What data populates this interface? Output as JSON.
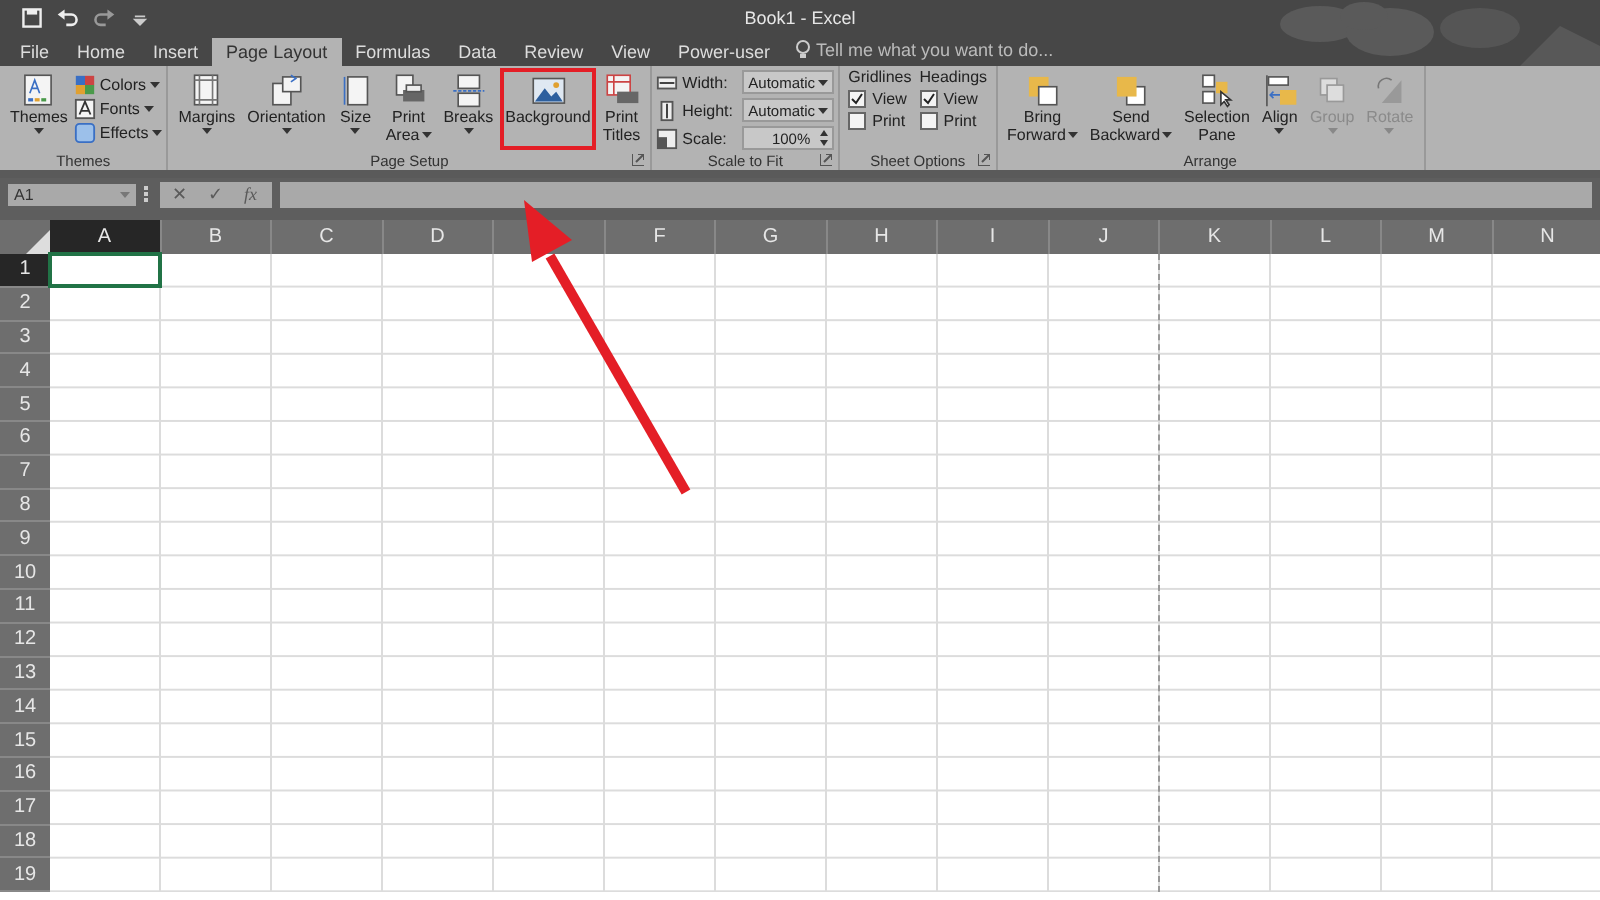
{
  "window": {
    "title": "Book1 - Excel"
  },
  "quick_access": [
    {
      "kind": "save"
    },
    {
      "kind": "undo"
    },
    {
      "kind": "redo"
    },
    {
      "kind": "customize"
    }
  ],
  "tabs": [
    {
      "label": "File",
      "selected": false
    },
    {
      "label": "Home",
      "selected": false
    },
    {
      "label": "Insert",
      "selected": false
    },
    {
      "label": "Page Layout",
      "selected": true
    },
    {
      "label": "Formulas",
      "selected": false
    },
    {
      "label": "Data",
      "selected": false
    },
    {
      "label": "Review",
      "selected": false
    },
    {
      "label": "View",
      "selected": false
    },
    {
      "label": "Power-user",
      "selected": false
    }
  ],
  "tell_me": {
    "placeholder": "Tell me what you want to do..."
  },
  "ribbon": {
    "groups": [
      {
        "label": "Themes",
        "launcher": false,
        "items": [
          {
            "kind": "big",
            "lines": [
              "Themes"
            ],
            "dropdown": true,
            "disabled": false,
            "highlighted": false
          },
          {
            "kind": "smalls",
            "entries": [
              {
                "label": "Colors"
              },
              {
                "label": "Fonts"
              },
              {
                "label": "Effects"
              }
            ]
          }
        ]
      },
      {
        "label": "Page Setup",
        "launcher": true,
        "items": [
          {
            "kind": "big",
            "lines": [
              "Margins"
            ],
            "dropdown": true,
            "disabled": false,
            "highlighted": false
          },
          {
            "kind": "big",
            "lines": [
              "Orientation"
            ],
            "dropdown": true,
            "disabled": false,
            "highlighted": false
          },
          {
            "kind": "big",
            "lines": [
              "Size"
            ],
            "dropdown": true,
            "disabled": false,
            "highlighted": false
          },
          {
            "kind": "big",
            "lines": [
              "Print",
              "Area"
            ],
            "dropdown": true,
            "disabled": false,
            "highlighted": false
          },
          {
            "kind": "big",
            "lines": [
              "Breaks"
            ],
            "dropdown": true,
            "disabled": false,
            "highlighted": false
          },
          {
            "kind": "big",
            "lines": [
              "Background"
            ],
            "dropdown": false,
            "disabled": false,
            "highlighted": true
          },
          {
            "kind": "big",
            "lines": [
              "Print",
              "Titles"
            ],
            "dropdown": false,
            "disabled": false,
            "highlighted": false
          }
        ]
      },
      {
        "label": "Scale to Fit",
        "launcher": true,
        "items": [
          {
            "kind": "fields",
            "rows": [
              {
                "kind": "dropdown",
                "label": "Width:",
                "value": "Automatic"
              },
              {
                "kind": "dropdown",
                "label": "Height:",
                "value": "Automatic"
              },
              {
                "kind": "spinner",
                "label": "Scale:",
                "value": "100%"
              }
            ]
          }
        ]
      },
      {
        "label": "Sheet Options",
        "launcher": true,
        "items": [
          {
            "kind": "checks",
            "heading": "Gridlines",
            "options": [
              {
                "label": "View",
                "checked": true
              },
              {
                "label": "Print",
                "checked": false
              }
            ]
          },
          {
            "kind": "checks",
            "heading": "Headings",
            "options": [
              {
                "label": "View",
                "checked": true
              },
              {
                "label": "Print",
                "checked": false
              }
            ]
          }
        ]
      },
      {
        "label": "Arrange",
        "launcher": false,
        "items": [
          {
            "kind": "big",
            "lines": [
              "Bring",
              "Forward"
            ],
            "dropdown": true,
            "disabled": false,
            "highlighted": false
          },
          {
            "kind": "big",
            "lines": [
              "Send",
              "Backward"
            ],
            "dropdown": true,
            "disabled": false,
            "highlighted": false
          },
          {
            "kind": "big",
            "lines": [
              "Selection",
              "Pane"
            ],
            "dropdown": false,
            "disabled": false,
            "highlighted": false
          },
          {
            "kind": "big",
            "lines": [
              "Align"
            ],
            "dropdown": true,
            "disabled": false,
            "highlighted": false
          },
          {
            "kind": "big",
            "lines": [
              "Group"
            ],
            "dropdown": true,
            "disabled": true,
            "highlighted": false
          },
          {
            "kind": "big",
            "lines": [
              "Rotate"
            ],
            "dropdown": true,
            "disabled": true,
            "highlighted": false
          }
        ]
      }
    ]
  },
  "formula_bar": {
    "name_box": "A1",
    "cancel": "✕",
    "enter": "✓",
    "function": "fx"
  },
  "sheet": {
    "columns": [
      {
        "label": "A",
        "selected": true,
        "page_break": false
      },
      {
        "label": "B",
        "selected": false,
        "page_break": false
      },
      {
        "label": "C",
        "selected": false,
        "page_break": false
      },
      {
        "label": "D",
        "selected": false,
        "page_break": false
      },
      {
        "selected": false,
        "page_break": false
      },
      {
        "label": "F",
        "selected": false,
        "page_break": false
      },
      {
        "label": "G",
        "selected": false,
        "page_break": false
      },
      {
        "label": "H",
        "selected": false,
        "page_break": false
      },
      {
        "label": "I",
        "selected": false,
        "page_break": false
      },
      {
        "label": "J",
        "selected": false,
        "page_break": true
      },
      {
        "label": "K",
        "selected": false,
        "page_break": false
      },
      {
        "label": "L",
        "selected": false,
        "page_break": false
      },
      {
        "label": "M",
        "selected": false,
        "page_break": false
      },
      {
        "label": "N",
        "selected": false,
        "page_break": false
      }
    ],
    "rows": [
      {
        "label": "1",
        "selected": true
      },
      {
        "label": "2",
        "selected": false
      },
      {
        "label": "3",
        "selected": false
      },
      {
        "label": "4",
        "selected": false
      },
      {
        "label": "5",
        "selected": false
      },
      {
        "label": "6",
        "selected": false
      },
      {
        "label": "7",
        "selected": false
      },
      {
        "label": "8",
        "selected": false
      },
      {
        "label": "9",
        "selected": false
      },
      {
        "label": "10",
        "selected": false
      },
      {
        "label": "11",
        "selected": false
      },
      {
        "label": "12",
        "selected": false
      },
      {
        "label": "13",
        "selected": false
      },
      {
        "label": "14",
        "selected": false
      },
      {
        "label": "15",
        "selected": false
      },
      {
        "label": "16",
        "selected": false
      },
      {
        "label": "17",
        "selected": false
      },
      {
        "label": "18",
        "selected": false
      },
      {
        "label": "19",
        "selected": false
      }
    ]
  },
  "annotation": {
    "arrow": true
  }
}
